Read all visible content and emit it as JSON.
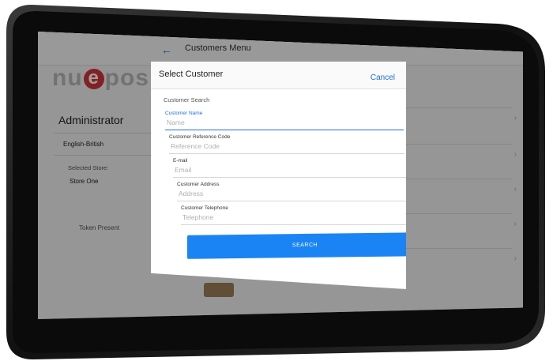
{
  "header": {
    "back_icon": "arrow-left-icon",
    "title": "Customers Menu"
  },
  "brand": {
    "logo_pre": "nu",
    "logo_e": "e",
    "logo_post": "pos"
  },
  "sidebar": {
    "user": "Administrator",
    "language": "English-British",
    "selected_store_label": "Selected Store:",
    "selected_store": "Store One",
    "token_status": "Token Present"
  },
  "modal": {
    "title": "Select Customer",
    "cancel_label": "Cancel",
    "section_label": "Customer Search",
    "fields": [
      {
        "label": "Customer Name",
        "placeholder": "Name"
      },
      {
        "label": "Customer Reference Code",
        "placeholder": "Reference Code"
      },
      {
        "label": "E-mail",
        "placeholder": "Email"
      },
      {
        "label": "Customer Address",
        "placeholder": "Address"
      },
      {
        "label": "Customer Telephone",
        "placeholder": "Telephone"
      }
    ],
    "search_label": "SEARCH"
  },
  "colors": {
    "accent": "#1a84f4",
    "link": "#1f6fe0",
    "logo_red": "#d4343a"
  }
}
